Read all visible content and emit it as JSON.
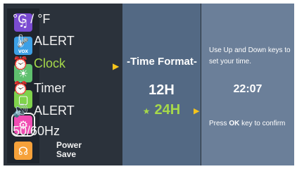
{
  "rail_icons": [
    {
      "name": "music-icon",
      "color": "#7a4bd1"
    },
    {
      "name": "mic-vox-icon",
      "color": "#3da0e6",
      "label": "VOX"
    },
    {
      "name": "brightness-icon",
      "color": "#5fc06e"
    },
    {
      "name": "baby-monitor-icon",
      "color": "#7fd24b"
    },
    {
      "name": "settings-gear-icon",
      "color": "#f04bb2"
    },
    {
      "name": "support-headset-icon",
      "color": "#f6a13a"
    }
  ],
  "menu": {
    "items": [
      {
        "label": "°C / °F",
        "icon": ""
      },
      {
        "label": "ALERT",
        "icon": "thermometer-icon"
      },
      {
        "label": "Clock",
        "icon": "clock-icon"
      },
      {
        "label": "Timer",
        "icon": "alarm-clock-icon"
      },
      {
        "label": "ALERT",
        "icon": "speaker-icon"
      },
      {
        "label": "50/60Hz",
        "icon": ""
      }
    ],
    "power_save": "Power\nSave"
  },
  "submenu": {
    "title": "-Time Format-",
    "options": [
      "12H",
      "24H"
    ],
    "selected": "24H"
  },
  "info": {
    "line1": "Use Up and Down keys to",
    "line2": "set your time.",
    "time": "22:07",
    "confirm_pre": "Press ",
    "confirm_key": "OK",
    "confirm_post": " key to confirm"
  }
}
